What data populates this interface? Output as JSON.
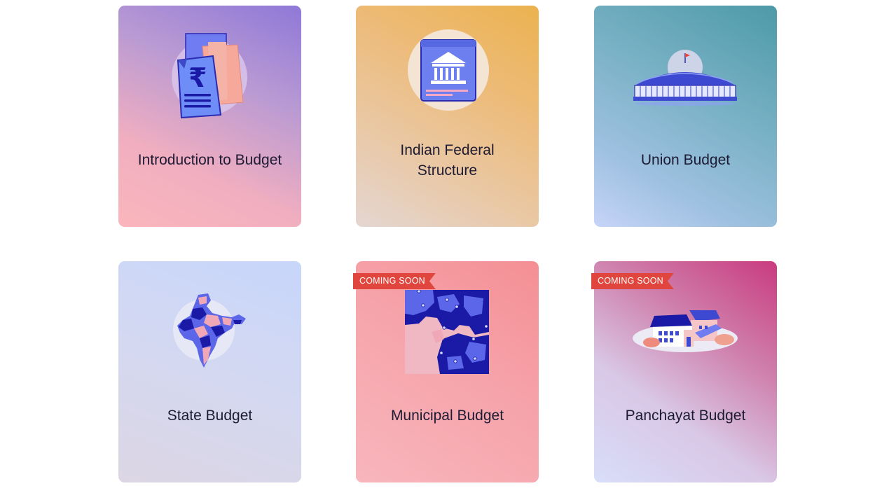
{
  "cards": [
    {
      "title": "Introduction to Budget",
      "icon": "budget-document-rupee-icon"
    },
    {
      "title_line1": "Indian Federal",
      "title_line2": "Structure",
      "icon": "government-building-icon"
    },
    {
      "title": "Union Budget",
      "icon": "parliament-building-icon"
    },
    {
      "title": "State Budget",
      "icon": "india-map-icon"
    },
    {
      "title": "Municipal Budget",
      "badge": "COMING SOON",
      "icon": "district-map-icon"
    },
    {
      "title": "Panchayat Budget",
      "badge": "COMING SOON",
      "icon": "village-houses-icon"
    }
  ],
  "colors": {
    "badge": "#e0453e",
    "title_text": "#1d1b33",
    "illustration_primary": "#5b66e8",
    "illustration_dark": "#1a1aa6"
  }
}
